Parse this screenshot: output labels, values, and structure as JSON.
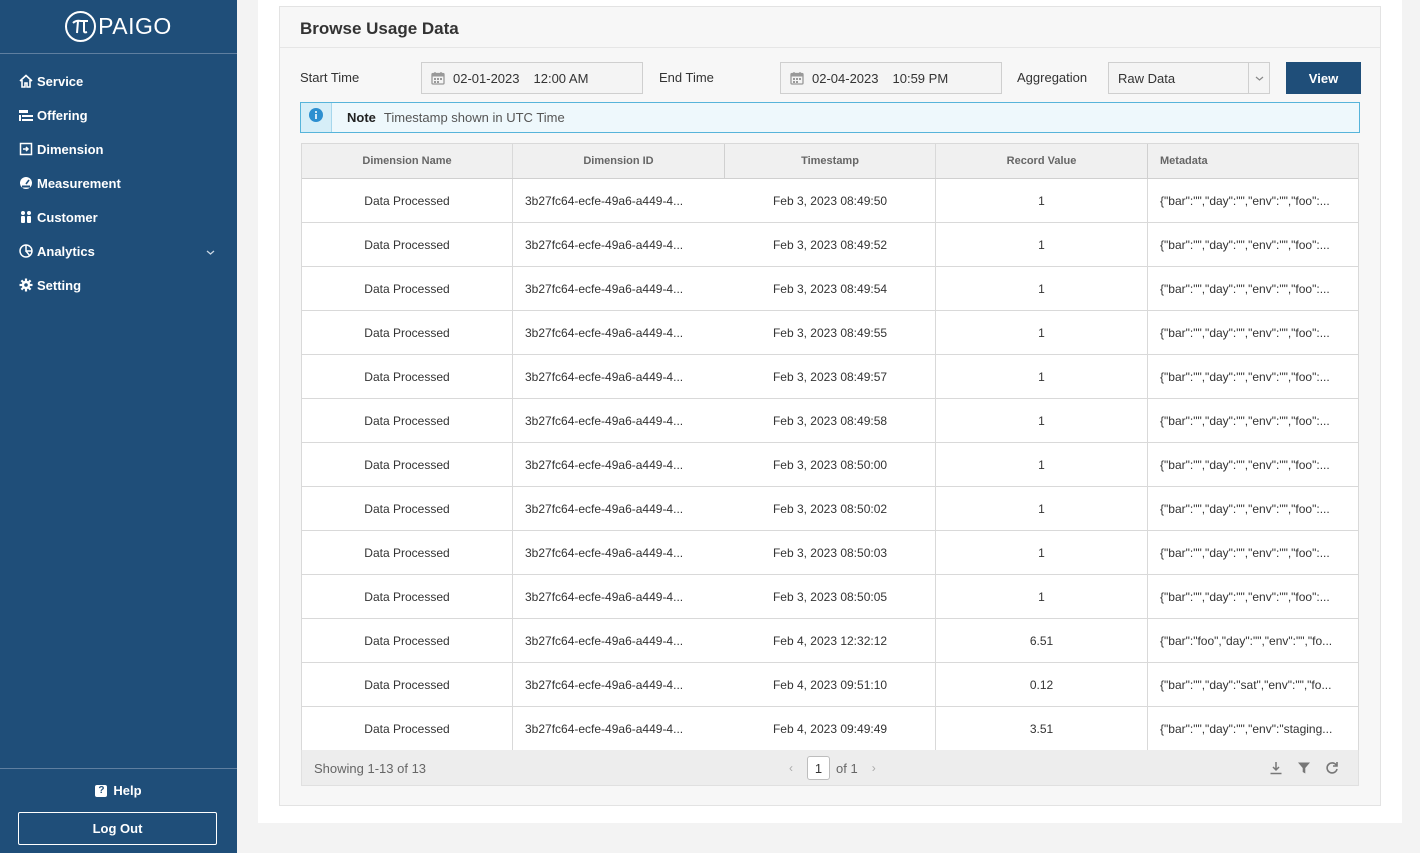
{
  "brand": {
    "name": "PAIGO"
  },
  "sidebar": {
    "items": [
      {
        "label": "Service",
        "icon": "home-icon"
      },
      {
        "label": "Offering",
        "icon": "offering-icon"
      },
      {
        "label": "Dimension",
        "icon": "dimension-icon"
      },
      {
        "label": "Measurement",
        "icon": "gauge-icon"
      },
      {
        "label": "Customer",
        "icon": "users-icon"
      },
      {
        "label": "Analytics",
        "icon": "chart-icon",
        "expandable": true
      },
      {
        "label": "Setting",
        "icon": "gear-icon"
      }
    ],
    "help_label": "Help",
    "logout_label": "Log Out"
  },
  "page": {
    "title": "Browse Usage Data"
  },
  "filters": {
    "start_label": "Start Time",
    "start_date": "02-01-2023",
    "start_time": "12:00 AM",
    "end_label": "End Time",
    "end_date": "02-04-2023",
    "end_time": "10:59 PM",
    "aggregation_label": "Aggregation",
    "aggregation_value": "Raw Data",
    "view_label": "View"
  },
  "note": {
    "title": "Note",
    "text": "Timestamp shown in UTC Time"
  },
  "table": {
    "columns": [
      "Dimension Name",
      "Dimension ID",
      "Timestamp",
      "Record Value",
      "Metadata"
    ],
    "rows": [
      [
        "Data Processed",
        "3b27fc64-ecfe-49a6-a449-4...",
        "Feb 3, 2023 08:49:50",
        "1",
        "{\"bar\":\"\",\"day\":\"\",\"env\":\"\",\"foo\":..."
      ],
      [
        "Data Processed",
        "3b27fc64-ecfe-49a6-a449-4...",
        "Feb 3, 2023 08:49:52",
        "1",
        "{\"bar\":\"\",\"day\":\"\",\"env\":\"\",\"foo\":..."
      ],
      [
        "Data Processed",
        "3b27fc64-ecfe-49a6-a449-4...",
        "Feb 3, 2023 08:49:54",
        "1",
        "{\"bar\":\"\",\"day\":\"\",\"env\":\"\",\"foo\":..."
      ],
      [
        "Data Processed",
        "3b27fc64-ecfe-49a6-a449-4...",
        "Feb 3, 2023 08:49:55",
        "1",
        "{\"bar\":\"\",\"day\":\"\",\"env\":\"\",\"foo\":..."
      ],
      [
        "Data Processed",
        "3b27fc64-ecfe-49a6-a449-4...",
        "Feb 3, 2023 08:49:57",
        "1",
        "{\"bar\":\"\",\"day\":\"\",\"env\":\"\",\"foo\":..."
      ],
      [
        "Data Processed",
        "3b27fc64-ecfe-49a6-a449-4...",
        "Feb 3, 2023 08:49:58",
        "1",
        "{\"bar\":\"\",\"day\":\"\",\"env\":\"\",\"foo\":..."
      ],
      [
        "Data Processed",
        "3b27fc64-ecfe-49a6-a449-4...",
        "Feb 3, 2023 08:50:00",
        "1",
        "{\"bar\":\"\",\"day\":\"\",\"env\":\"\",\"foo\":..."
      ],
      [
        "Data Processed",
        "3b27fc64-ecfe-49a6-a449-4...",
        "Feb 3, 2023 08:50:02",
        "1",
        "{\"bar\":\"\",\"day\":\"\",\"env\":\"\",\"foo\":..."
      ],
      [
        "Data Processed",
        "3b27fc64-ecfe-49a6-a449-4...",
        "Feb 3, 2023 08:50:03",
        "1",
        "{\"bar\":\"\",\"day\":\"\",\"env\":\"\",\"foo\":..."
      ],
      [
        "Data Processed",
        "3b27fc64-ecfe-49a6-a449-4...",
        "Feb 3, 2023 08:50:05",
        "1",
        "{\"bar\":\"\",\"day\":\"\",\"env\":\"\",\"foo\":..."
      ],
      [
        "Data Processed",
        "3b27fc64-ecfe-49a6-a449-4...",
        "Feb 4, 2023 12:32:12",
        "6.51",
        "{\"bar\":\"foo\",\"day\":\"\",\"env\":\"\",\"fo..."
      ],
      [
        "Data Processed",
        "3b27fc64-ecfe-49a6-a449-4...",
        "Feb 4, 2023 09:51:10",
        "0.12",
        "{\"bar\":\"\",\"day\":\"sat\",\"env\":\"\",\"fo..."
      ],
      [
        "Data Processed",
        "3b27fc64-ecfe-49a6-a449-4...",
        "Feb 4, 2023 09:49:49",
        "3.51",
        "{\"bar\":\"\",\"day\":\"\",\"env\":\"staging..."
      ]
    ]
  },
  "footer": {
    "showing": "Showing 1-13 of 13",
    "page": "1",
    "of_pages": "of 1"
  },
  "colors": {
    "sidebar_bg": "#1f4e79",
    "primary_button": "#1f4e79",
    "note_border": "#57b4da",
    "note_icon": "#2d8fd0"
  }
}
